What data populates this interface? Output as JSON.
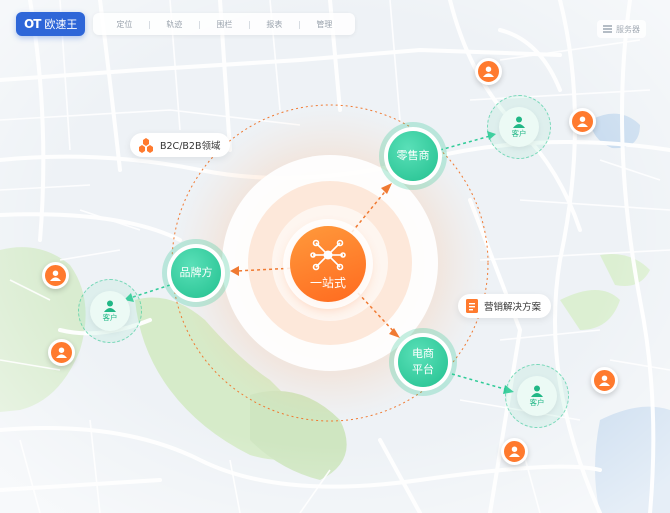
{
  "app": {
    "logo_text": "欧速王",
    "logo_mark": "OT"
  },
  "nav": [
    "定位",
    "轨迹",
    "围栏",
    "报表",
    "管理"
  ],
  "server_label": "服务器",
  "tags": {
    "b2c": "B2C/B2B领域",
    "marketing": "营销解决方案"
  },
  "hub": {
    "label": "一站式"
  },
  "nodes": {
    "retailer": "零售商",
    "brand": "品牌方",
    "ecommerce_line1": "电商",
    "ecommerce_line2": "平台"
  },
  "client_label": "客户",
  "colors": {
    "accent_orange": "#ff7a2e",
    "accent_green": "#2ecb97",
    "brand_blue": "#2e66d8"
  }
}
